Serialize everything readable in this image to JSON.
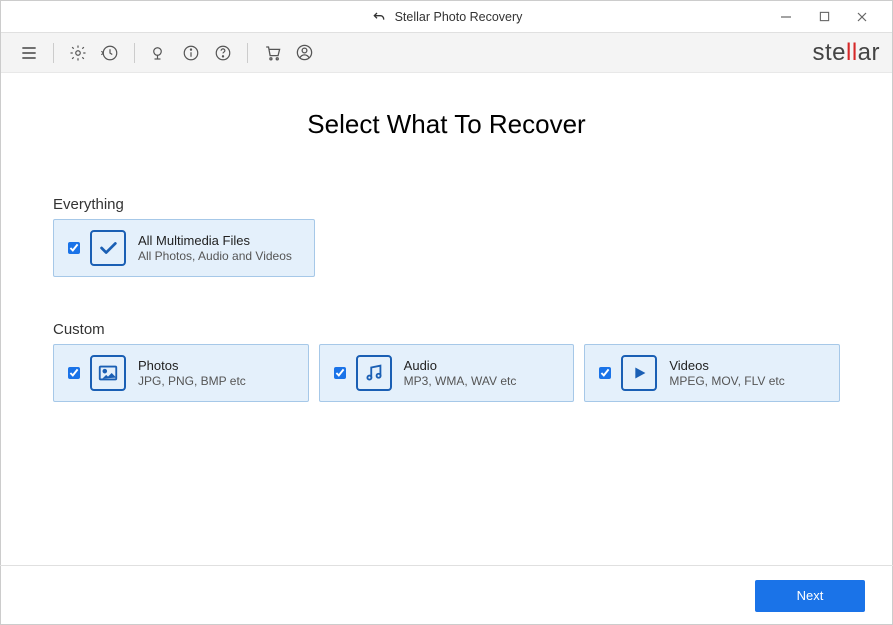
{
  "titlebar": {
    "title": "Stellar Photo Recovery"
  },
  "brand": {
    "pre": "ste",
    "highlight": "ll",
    "post": "ar"
  },
  "heading": "Select What To Recover",
  "sections": {
    "everything": {
      "label": "Everything",
      "card": {
        "title": "All Multimedia Files",
        "sub": "All Photos, Audio and Videos",
        "checked": true
      }
    },
    "custom": {
      "label": "Custom",
      "cards": {
        "photos": {
          "title": "Photos",
          "sub": "JPG, PNG, BMP etc",
          "checked": true
        },
        "audio": {
          "title": "Audio",
          "sub": "MP3, WMA, WAV etc",
          "checked": true
        },
        "videos": {
          "title": "Videos",
          "sub": "MPEG, MOV, FLV etc",
          "checked": true
        }
      }
    }
  },
  "footer": {
    "next": "Next"
  }
}
